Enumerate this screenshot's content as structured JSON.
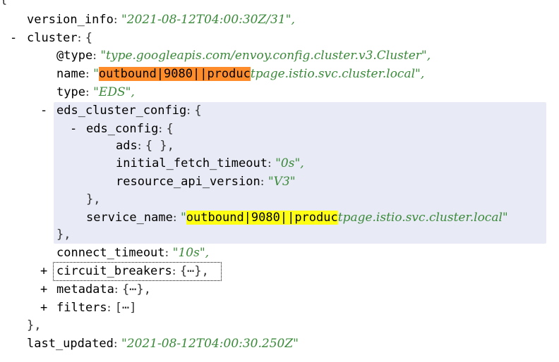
{
  "root_open": "{",
  "version_info": {
    "key": "version_info",
    "value": "\"2021-08-12T04:00:30Z/31\","
  },
  "cluster": {
    "toggle": "-",
    "key": "cluster",
    "open": "{",
    "type_at": {
      "key": "@type",
      "value": "\"type.googleapis.com/envoy.config.cluster.v3.Cluster\","
    },
    "name": {
      "key": "name",
      "quote_open": "\"",
      "highlight": "outbound|9080||produc",
      "rest": "tpage.istio.svc.cluster.local\","
    },
    "type": {
      "key": "type",
      "value": "\"EDS\","
    },
    "eds_cluster_config": {
      "toggle": "-",
      "key": "eds_cluster_config",
      "open": "{",
      "eds_config": {
        "toggle": "-",
        "key": "eds_config",
        "open": "{",
        "ads": {
          "key": "ads",
          "value": "{ },"
        },
        "initial_fetch_timeout": {
          "key": "initial_fetch_timeout",
          "value": "\"0s\","
        },
        "resource_api_version": {
          "key": "resource_api_version",
          "value": "\"V3\""
        },
        "close": "},"
      },
      "service_name": {
        "key": "service_name",
        "quote_open": "\"",
        "highlight": "outbound|9080||produc",
        "rest": "tpage.istio.svc.cluster.local\""
      },
      "close": "},"
    },
    "connect_timeout": {
      "key": "connect_timeout",
      "value": "\"10s\","
    },
    "circuit_breakers": {
      "toggle": "+",
      "key": "circuit_breakers",
      "value": "{⋯},"
    },
    "metadata": {
      "toggle": "+",
      "key": "metadata",
      "value": "{⋯},"
    },
    "filters": {
      "toggle": "+",
      "key": "filters",
      "value": "[⋯]"
    },
    "close": "},"
  },
  "last_updated": {
    "key": "last_updated",
    "value": "\"2021-08-12T04:00:30.250Z\""
  },
  "colors": {
    "string": "#3a8a3a",
    "highlight_name": "#ff8c2a",
    "highlight_service": "#ffff14",
    "block_bg": "#e8eaf5"
  }
}
